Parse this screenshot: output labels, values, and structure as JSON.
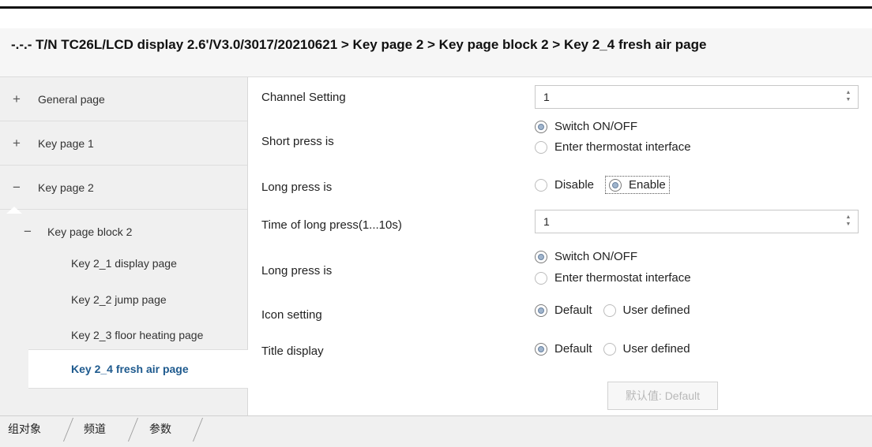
{
  "breadcrumb": "-.-.- T/N TC26L/LCD display 2.6'/V3.0/3017/20210621 > Key page 2 > Key page block 2 > Key 2_4 fresh air page",
  "sidebar": {
    "items": [
      {
        "sign": "+",
        "label": "General page"
      },
      {
        "sign": "+",
        "label": "Key page 1"
      },
      {
        "sign": "−",
        "label": "Key page 2"
      },
      {
        "sign": "−",
        "label": "Key page block 2"
      },
      {
        "label": "Key 2_1 display page"
      },
      {
        "label": "Key 2_2 jump page"
      },
      {
        "label": "Key 2_3 floor heating page"
      },
      {
        "label": "Key 2_4 fresh air page"
      }
    ]
  },
  "params": {
    "channel_setting": {
      "label": "Channel Setting",
      "value": "1"
    },
    "short_press": {
      "label": "Short press is",
      "options": [
        "Switch ON/OFF",
        "Enter thermostat interface"
      ],
      "selected": "Switch ON/OFF"
    },
    "long_press": {
      "label": "Long press is",
      "options": [
        "Disable",
        "Enable"
      ],
      "selected": "Enable"
    },
    "long_press_time": {
      "label": "Time of long press(1...10s)",
      "value": "1"
    },
    "long_press_action": {
      "label": "Long press is",
      "options": [
        "Switch ON/OFF",
        "Enter thermostat interface"
      ],
      "selected": "Switch ON/OFF"
    },
    "icon_setting": {
      "label": "Icon setting",
      "options": [
        "Default",
        "User defined"
      ],
      "selected": "Default"
    },
    "title_display": {
      "label": "Title display",
      "options": [
        "Default",
        "User defined"
      ],
      "selected": "Default"
    },
    "default_button": "默认值: Default"
  },
  "tabs": [
    "组对象",
    "频道",
    "参数"
  ],
  "colors": {
    "selected_text": "#1e5a8e",
    "sidebar_bg": "#f0f0f0",
    "breadcrumb_bg": "#f6f6f6"
  }
}
